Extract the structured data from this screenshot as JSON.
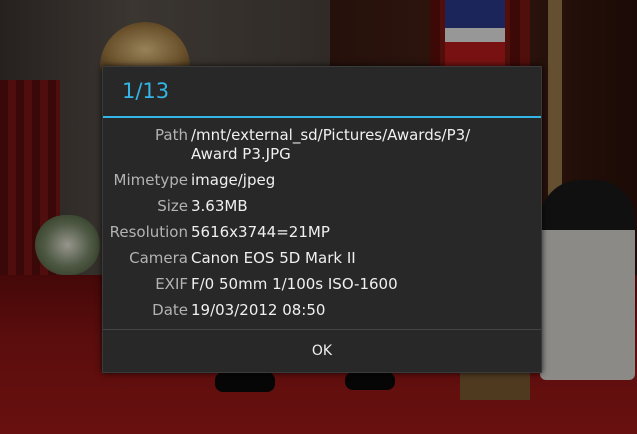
{
  "dialog": {
    "title": "1/13",
    "rows": [
      {
        "label": "Path",
        "value": "/mnt/external_sd/Pictures/Awards/P3/\nAward P3.JPG"
      },
      {
        "label": "Mimetype",
        "value": "image/jpeg"
      },
      {
        "label": "Size",
        "value": "3.63MB"
      },
      {
        "label": "Resolution",
        "value": "5616x3744=21MP"
      },
      {
        "label": "Camera",
        "value": "Canon EOS 5D Mark II"
      },
      {
        "label": "EXIF",
        "value": "F/0 50mm 1/100s ISO-1600"
      },
      {
        "label": "Date",
        "value": "19/03/2012 08:50"
      }
    ],
    "ok_label": "OK"
  },
  "colors": {
    "accent": "#33b5e5",
    "dialog_bg": "#282828"
  }
}
